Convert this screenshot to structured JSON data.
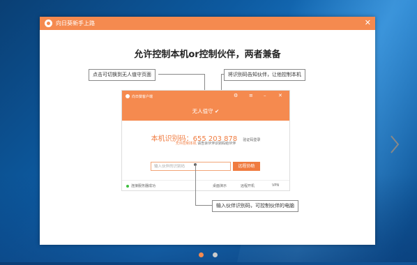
{
  "window": {
    "title": "向日葵新手上路",
    "close_glyph": "✕",
    "heading": "允许控制本机or控制伙伴，两者兼备"
  },
  "callouts": {
    "switch_unattended": "点击可切换到无人值守页面",
    "share_code": "将识别码告知伙伴，让他控制本机",
    "enter_partner": "输入伙伴识别码，可控制伙伴的电脑"
  },
  "mini_app": {
    "title": "向日葵客户端",
    "status": "无人值守 ✔",
    "code_label": "本机识别码：655 203 878",
    "code_link": "验证码登录",
    "hint_link": "允许控制本机",
    "hint_text": "请告诉伙伴识别码给伙伴",
    "input_placeholder": "输入伙伴的识别码",
    "connect_button": "远程协助",
    "footer": {
      "connected": "连接服务器成功",
      "desktop": "桌面演示",
      "remote_boot": "远程开机",
      "vpn": "VPN"
    }
  },
  "colors": {
    "accent": "#f58a4f",
    "pager_active": "#f58a4f",
    "pager_inactive": "#cccccc"
  },
  "pager": {
    "count": 2,
    "active": 1
  }
}
